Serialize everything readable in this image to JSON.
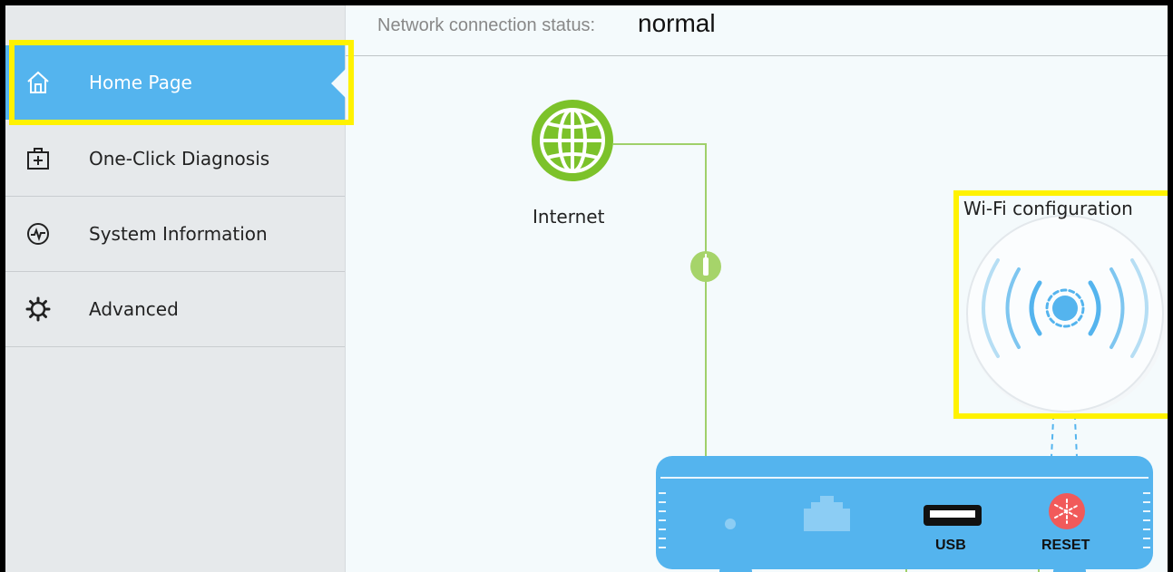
{
  "sidebar": {
    "items": [
      {
        "label": "Home Page",
        "icon": "home-icon",
        "active": true
      },
      {
        "label": "One-Click Diagnosis",
        "icon": "medical-kit-icon",
        "active": false
      },
      {
        "label": "System Information",
        "icon": "pulse-icon",
        "active": false
      },
      {
        "label": "Advanced",
        "icon": "gear-icon",
        "active": false
      }
    ]
  },
  "status": {
    "label": "Network connection status:",
    "value": "normal"
  },
  "diagram": {
    "internet_label": "Internet",
    "wifi_label": "Wi-Fi configuration",
    "usb_label": "USB",
    "reset_label": "RESET"
  },
  "colors": {
    "accent": "#54b4ee",
    "internet_green": "#7cc22a",
    "highlight": "#fff200",
    "reset_red": "#f15a5a"
  }
}
